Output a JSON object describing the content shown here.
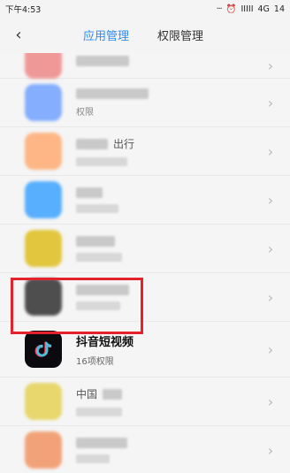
{
  "status": {
    "time": "下午4:53",
    "network": "4G",
    "battery": "14",
    "signal_text": "IIIII",
    "alarm_icon": "alarm-clock-icon",
    "dots": "···"
  },
  "nav": {
    "tabs": [
      {
        "label": "应用管理",
        "active": true
      },
      {
        "label": "权限管理",
        "active": false
      }
    ]
  },
  "list": {
    "blurred_rows": [
      {
        "icon_color": "#ef8f8f"
      },
      {
        "icon_color": "#7aa7ff"
      },
      {
        "icon_color": "#ffb07a"
      },
      {
        "icon_color": "#47a8ff"
      },
      {
        "icon_color": "#e1c12a"
      },
      {
        "icon_color": "#3c3c3c"
      },
      {
        "icon_color": "#e6d45f"
      },
      {
        "icon_color": "#f29a6b"
      }
    ],
    "partial_text": {
      "row2_permissions": "权限",
      "row3_title_suffix": "出行",
      "row7_title": "中国"
    },
    "focused_app": {
      "name": "抖音短视频",
      "permissions": "16项权限",
      "icon": "tiktok-icon"
    }
  }
}
